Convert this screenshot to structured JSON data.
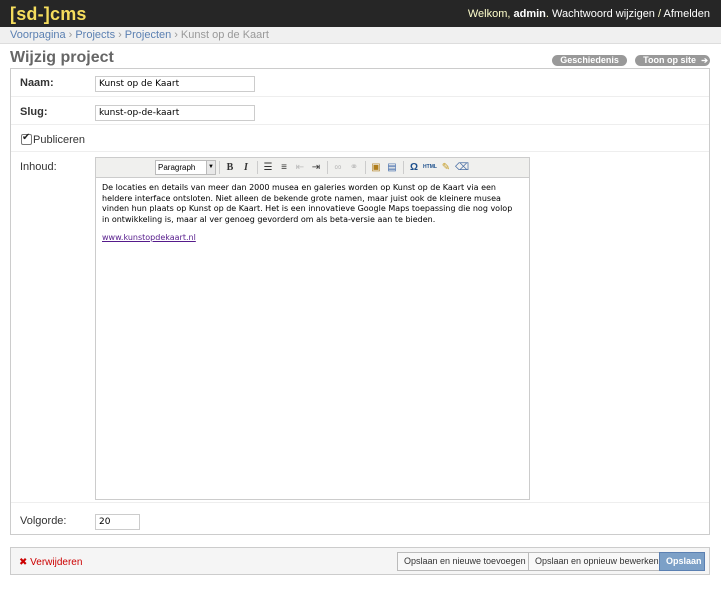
{
  "header": {
    "brand": "[sd-]cms",
    "welcome": "Welkom,",
    "username": "admin",
    "change_password": "Wachtwoord wijzigen",
    "separator": "/",
    "logout": "Afmelden"
  },
  "breadcrumbs": {
    "items": [
      "Voorpagina",
      "Projects",
      "Projecten"
    ],
    "current": "Kunst op de Kaart",
    "sep": "›"
  },
  "page": {
    "title": "Wijzig project"
  },
  "object_tools": {
    "history": "Geschiedenis",
    "view_on_site": "Toon op site"
  },
  "form": {
    "name_label": "Naam:",
    "name_value": "Kunst op de Kaart",
    "slug_label": "Slug:",
    "slug_value": "kunst-op-de-kaart",
    "publish_label": "Publiceren",
    "publish_checked": true,
    "content_label": "Inhoud:",
    "order_label": "Volgorde:",
    "order_value": "20"
  },
  "editor": {
    "format": "Paragraph",
    "toolbar_icons": [
      "bold-icon",
      "italic-icon",
      "bullet-list-icon",
      "numbered-list-icon",
      "outdent-icon",
      "indent-icon",
      "link-icon",
      "unlink-icon",
      "paste-icon",
      "paste-word-icon",
      "special-char-icon",
      "html-icon",
      "cleanup-icon",
      "remove-format-icon"
    ],
    "paragraph": "De locaties en details van meer dan 2000 musea en galeries worden op Kunst op de Kaart via een heldere interface ontsloten. Niet alleen de bekende grote namen, maar juist ook de kleinere musea vinden hun plaats op Kunst op de Kaart. Het is een innovatieve Google Maps toepassing die nog volop in ontwikkeling is, maar al ver genoeg gevorderd om als beta-versie aan te bieden.",
    "link": "www.kunstopdekaart.nl"
  },
  "actions": {
    "delete": "Verwijderen",
    "save_add": "Opslaan en nieuwe toevoegen",
    "save_continue": "Opslaan en opnieuw bewerken",
    "save": "Opslaan"
  },
  "colors": {
    "header_bg": "#262626",
    "brand": "#f5dd5d",
    "link": "#5b80b2",
    "delete": "#cc0000",
    "primary_button": "#7ca0c7"
  }
}
